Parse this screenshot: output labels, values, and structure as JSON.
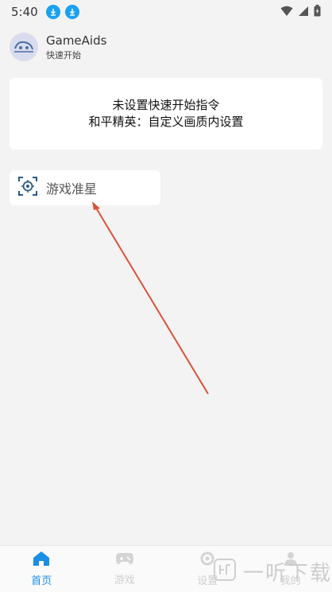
{
  "status_bar": {
    "time": "5:40"
  },
  "header": {
    "app_name": "GameAids",
    "subtitle": "快速开始"
  },
  "info_card": {
    "line1": "未设置快速开始指令",
    "line2": "和平精英：自定义画质内设置"
  },
  "feature": {
    "label": "游戏准星",
    "icon": "crosshair-icon"
  },
  "nav": {
    "items": [
      {
        "label": "首页",
        "icon": "home-icon",
        "active": true
      },
      {
        "label": "游戏",
        "icon": "gamepad-icon",
        "active": false
      },
      {
        "label": "设置",
        "icon": "settings-icon",
        "active": false
      },
      {
        "label": "我的",
        "icon": "user-icon",
        "active": false
      }
    ]
  },
  "watermark": {
    "text": "一听下载"
  },
  "colors": {
    "accent": "#1a8fe3",
    "arrow": "#d9533a",
    "download_badge": "#1aa1f0"
  }
}
